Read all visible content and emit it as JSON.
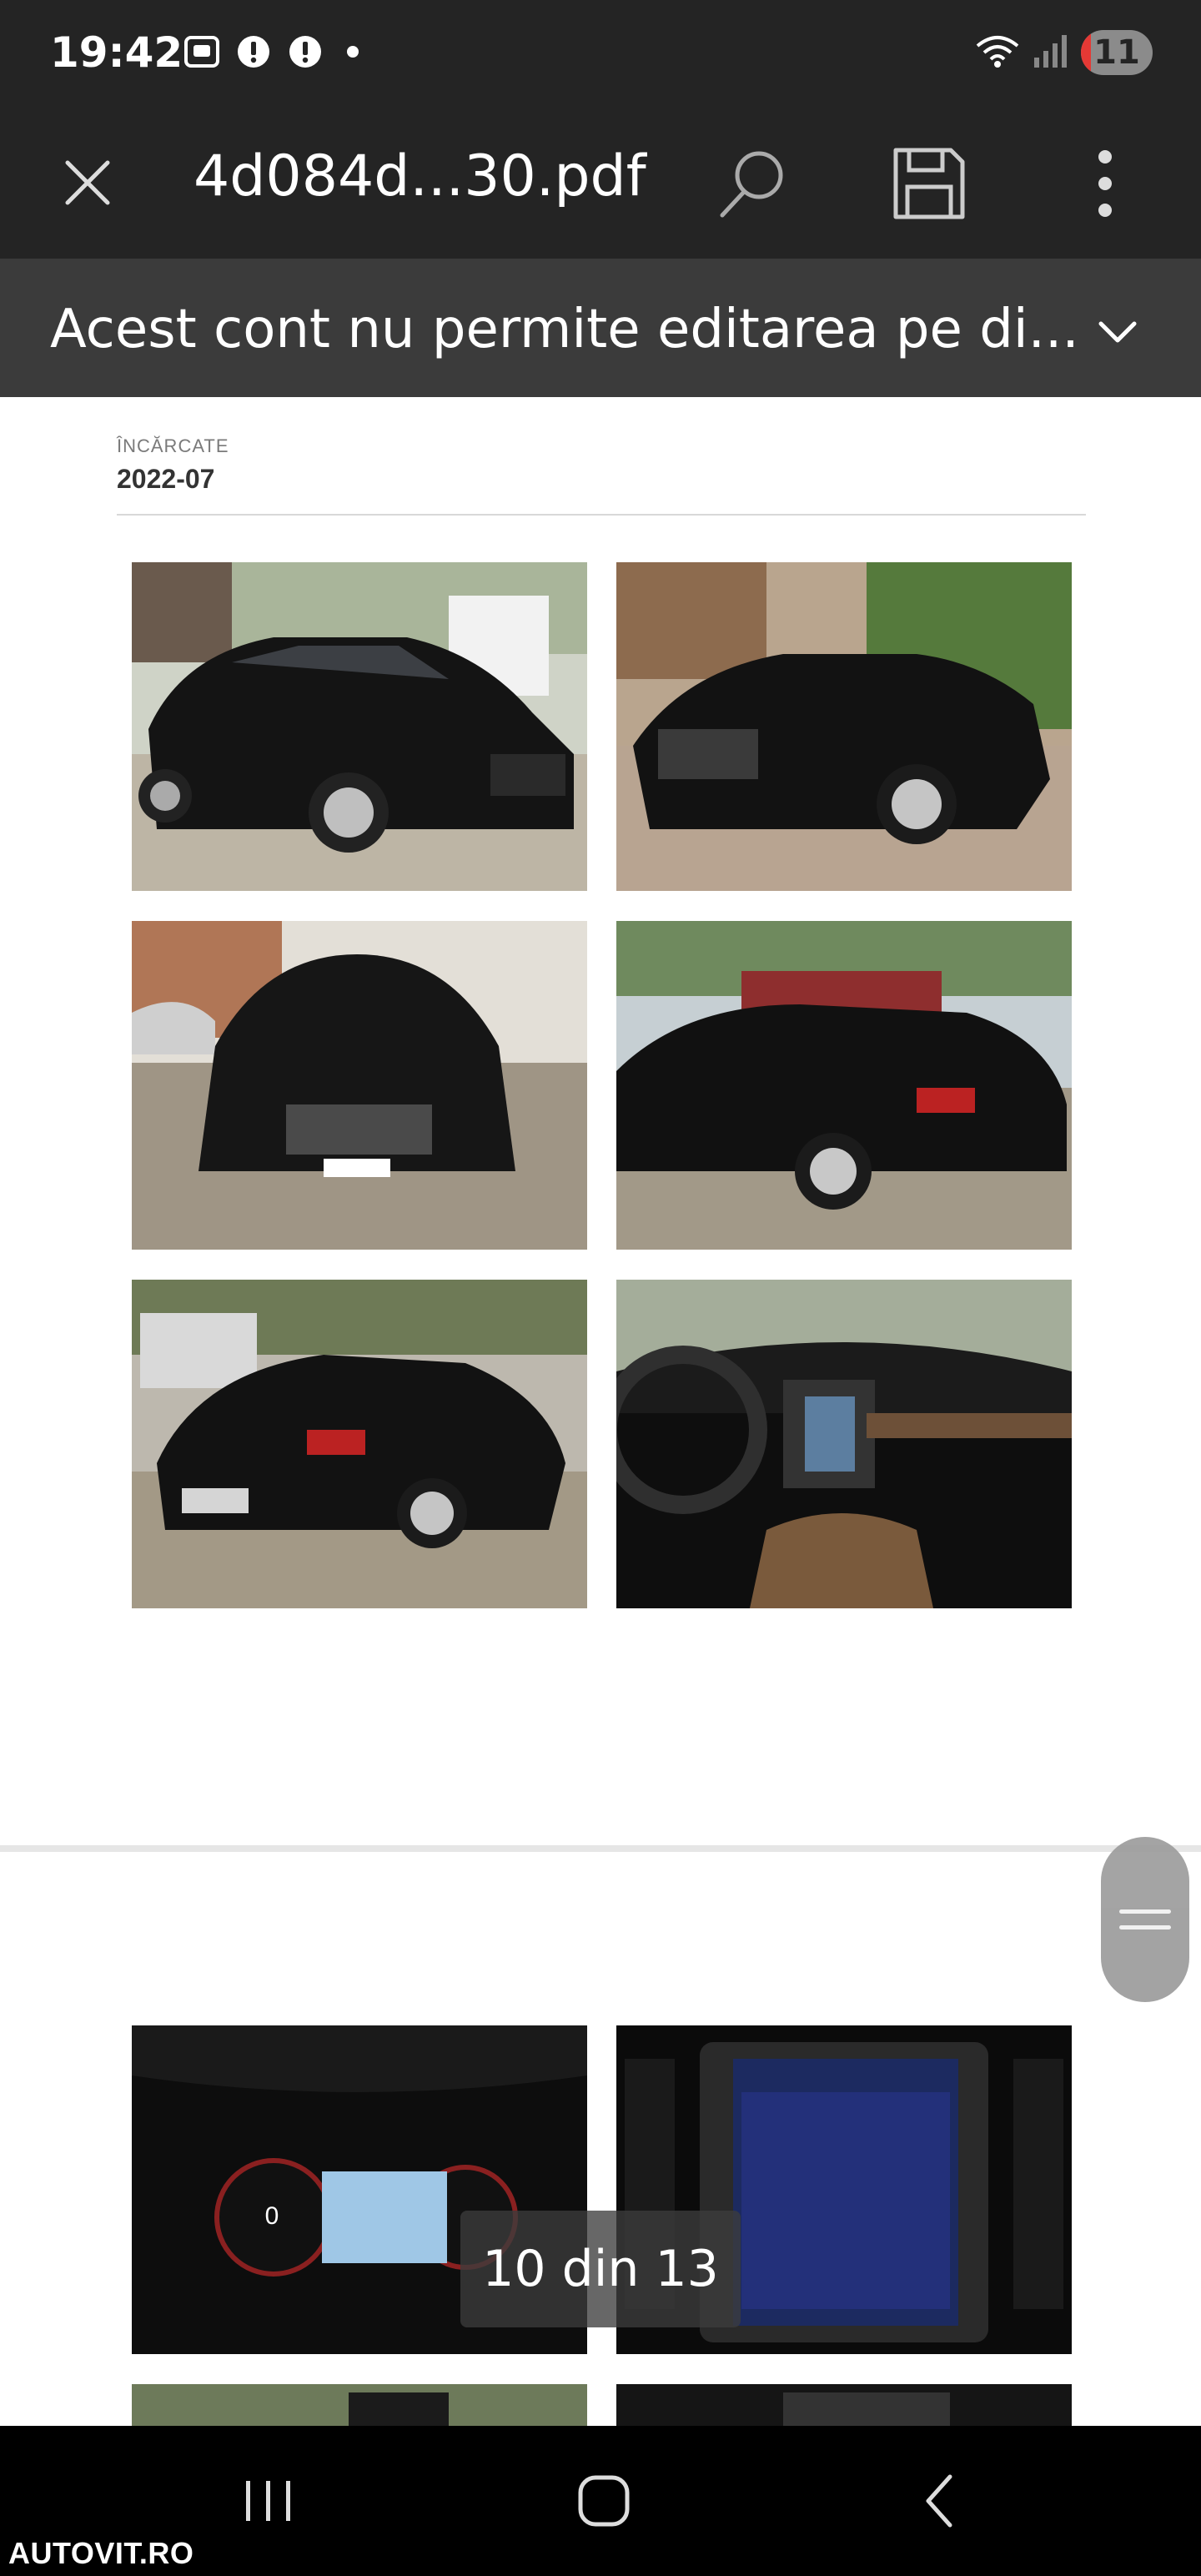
{
  "status_bar": {
    "time": "19:42",
    "icons_left": [
      "screenshot-icon",
      "alert-icon",
      "alert-icon",
      "dot-icon"
    ],
    "icons_right": [
      "wifi-icon",
      "signal-icon"
    ],
    "battery_level": "11"
  },
  "toolbar": {
    "title": "4d084d...30.pdf",
    "actions": [
      "close-icon",
      "search-icon",
      "save-icon",
      "more-icon"
    ]
  },
  "banner": {
    "text": "Acest cont nu permite editarea pe di..."
  },
  "document": {
    "meta_label": "ÎNCĂRCATE",
    "meta_value": "2022-07"
  },
  "page_indicator": "10 din 13",
  "watermark": "AUTOVIT.RO",
  "colors": {
    "toolbar_bg": "#242424",
    "banner_bg": "#3b3b3b",
    "nav_bg": "#000000"
  }
}
